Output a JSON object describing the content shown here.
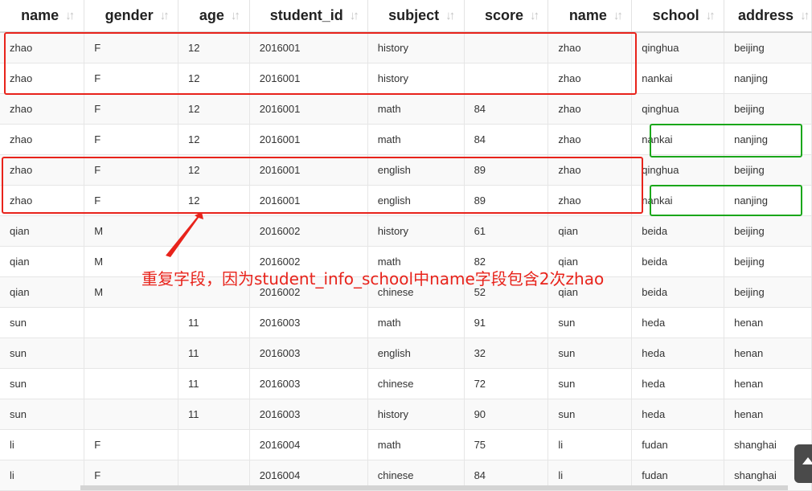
{
  "table": {
    "columns": [
      "name",
      "gender",
      "age",
      "student_id",
      "subject",
      "score",
      "name",
      "school",
      "address"
    ],
    "sort_icon": "sort-arrows-icon",
    "rows": [
      [
        "zhao",
        "F",
        "12",
        "2016001",
        "history",
        "",
        "zhao",
        "qinghua",
        "beijing"
      ],
      [
        "zhao",
        "F",
        "12",
        "2016001",
        "history",
        "",
        "zhao",
        "nankai",
        "nanjing"
      ],
      [
        "zhao",
        "F",
        "12",
        "2016001",
        "math",
        "84",
        "zhao",
        "qinghua",
        "beijing"
      ],
      [
        "zhao",
        "F",
        "12",
        "2016001",
        "math",
        "84",
        "zhao",
        "nankai",
        "nanjing"
      ],
      [
        "zhao",
        "F",
        "12",
        "2016001",
        "english",
        "89",
        "zhao",
        "qinghua",
        "beijing"
      ],
      [
        "zhao",
        "F",
        "12",
        "2016001",
        "english",
        "89",
        "zhao",
        "nankai",
        "nanjing"
      ],
      [
        "qian",
        "M",
        "",
        "2016002",
        "history",
        "61",
        "qian",
        "beida",
        "beijing"
      ],
      [
        "qian",
        "M",
        "",
        "2016002",
        "math",
        "82",
        "qian",
        "beida",
        "beijing"
      ],
      [
        "qian",
        "M",
        "",
        "2016002",
        "chinese",
        "52",
        "qian",
        "beida",
        "beijing"
      ],
      [
        "sun",
        "",
        "11",
        "2016003",
        "math",
        "91",
        "sun",
        "heda",
        "henan"
      ],
      [
        "sun",
        "",
        "11",
        "2016003",
        "english",
        "32",
        "sun",
        "heda",
        "henan"
      ],
      [
        "sun",
        "",
        "11",
        "2016003",
        "chinese",
        "72",
        "sun",
        "heda",
        "henan"
      ],
      [
        "sun",
        "",
        "11",
        "2016003",
        "history",
        "90",
        "sun",
        "heda",
        "henan"
      ],
      [
        "li",
        "F",
        "",
        "2016004",
        "math",
        "75",
        "li",
        "fudan",
        "shanghai"
      ],
      [
        "li",
        "F",
        "",
        "2016004",
        "chinese",
        "84",
        "li",
        "fudan",
        "shanghai"
      ]
    ]
  },
  "annotation": {
    "text": "重复字段，因为student_info_school中name字段包含2次zhao",
    "color": "#e8231b"
  },
  "highlight_colors": {
    "red": "#e8231b",
    "green": "#1aa71a"
  },
  "icons": {
    "corner_button": "chevron-up-icon"
  }
}
